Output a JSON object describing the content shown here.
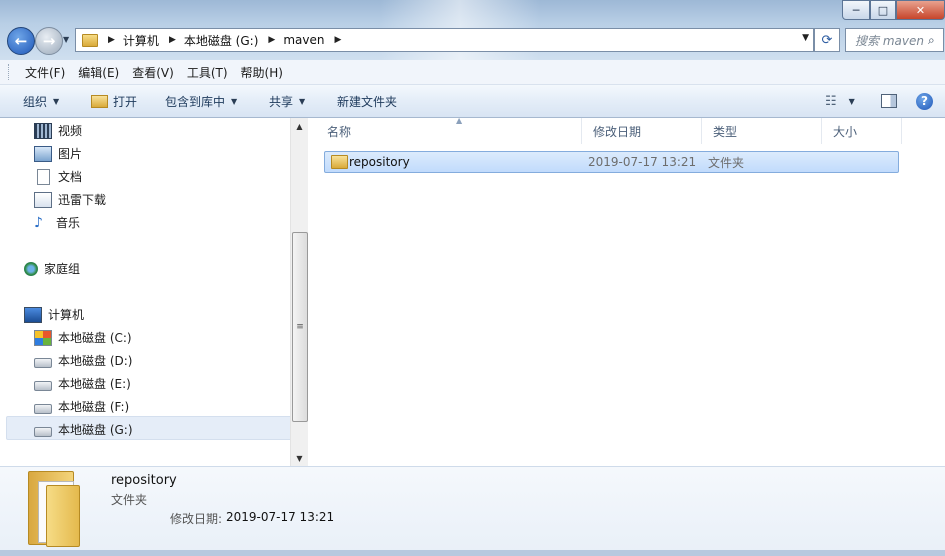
{
  "window": {
    "controls": {
      "minimize": "─",
      "maximize": "□",
      "close": "✕"
    }
  },
  "address": {
    "breadcrumbs": [
      "计算机",
      "本地磁盘 (G:)",
      "maven"
    ],
    "search_placeholder": "搜索 maven"
  },
  "menubar": [
    "文件(F)",
    "编辑(E)",
    "查看(V)",
    "工具(T)",
    "帮助(H)"
  ],
  "commandbar": {
    "organize": "组织",
    "open": "打开",
    "include_in_library": "包含到库中",
    "share": "共享",
    "new_folder": "新建文件夹"
  },
  "navpane": {
    "libraries": [
      "视频",
      "图片",
      "文档",
      "迅雷下载",
      "音乐"
    ],
    "homegroup": "家庭组",
    "computer": "计算机",
    "drives": [
      "本地磁盘 (C:)",
      "本地磁盘 (D:)",
      "本地磁盘 (E:)",
      "本地磁盘 (F:)",
      "本地磁盘 (G:)"
    ],
    "selected": "本地磁盘 (G:)"
  },
  "columns": [
    "名称",
    "修改日期",
    "类型",
    "大小"
  ],
  "files": [
    {
      "name": "repository",
      "modified": "2019-07-17 13:21",
      "type": "文件夹",
      "size": ""
    }
  ],
  "details": {
    "name": "repository",
    "type": "文件夹",
    "modified_label": "修改日期:",
    "modified_value": "2019-07-17 13:21"
  },
  "icons": {
    "back": "back-arrow-icon",
    "forward": "forward-arrow-icon",
    "refresh": "refresh-icon",
    "search": "search-icon",
    "help": "help-icon",
    "folder": "folder-icon"
  }
}
